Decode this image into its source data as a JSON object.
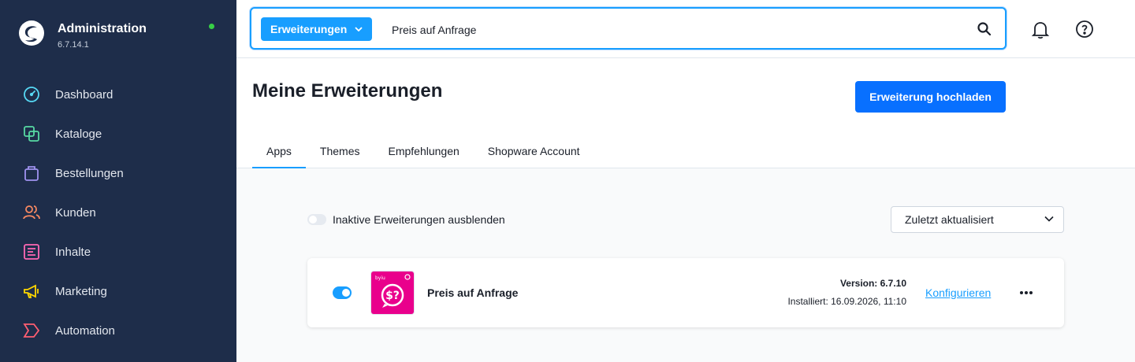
{
  "app": {
    "title": "Administration",
    "version": "6.7.14.1"
  },
  "sidebar": {
    "items": [
      {
        "label": "Dashboard",
        "icon": "dashboard-icon",
        "color": "#57d9f5"
      },
      {
        "label": "Kataloge",
        "icon": "catalog-icon",
        "color": "#57d9a3"
      },
      {
        "label": "Bestellungen",
        "icon": "bag-icon",
        "color": "#a092f0"
      },
      {
        "label": "Kunden",
        "icon": "users-icon",
        "color": "#f88962"
      },
      {
        "label": "Inhalte",
        "icon": "content-icon",
        "color": "#ff68b4"
      },
      {
        "label": "Marketing",
        "icon": "megaphone-icon",
        "color": "#ffd700"
      },
      {
        "label": "Automation",
        "icon": "automation-icon",
        "color": "#ff5e71"
      }
    ]
  },
  "search": {
    "type_label": "Erweiterungen",
    "value": "Preis auf Anfrage"
  },
  "page": {
    "title": "Meine Erweiterungen",
    "upload_label": "Erweiterung hochladen",
    "tabs": [
      {
        "label": "Apps",
        "active": true
      },
      {
        "label": "Themes"
      },
      {
        "label": "Empfehlungen"
      },
      {
        "label": "Shopware Account"
      }
    ]
  },
  "filter": {
    "hide_inactive_label": "Inaktive Erweiterungen ausblenden",
    "sort_value": "Zuletzt aktualisiert"
  },
  "extension": {
    "active": true,
    "name": "Preis auf Anfrage",
    "version": "Version: 6.7.10",
    "installed": "Installiert: 16.09.2026, 11:10",
    "configure_label": "Konfigurieren",
    "icon_color": "#e9008c"
  }
}
